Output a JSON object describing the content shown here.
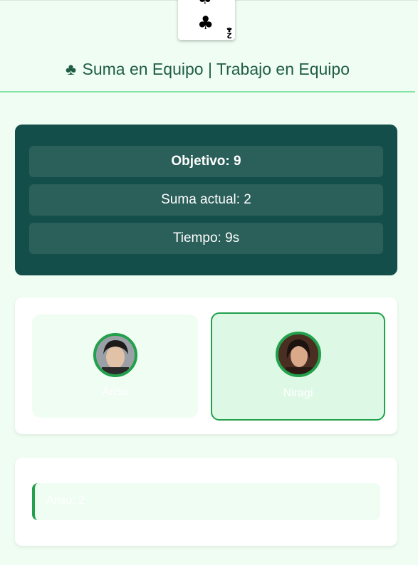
{
  "card": {
    "rank": "2",
    "suit_symbol": "♣"
  },
  "header": {
    "suit_icon": "♣",
    "title": "Suma en Equipo | Trabajo en Equipo"
  },
  "stats": {
    "objective_label": "Objetivo: 9",
    "current_sum_label": "Suma actual: 2",
    "time_label": "Tiempo: 9s"
  },
  "players": [
    {
      "name": "Arisu",
      "selected": false
    },
    {
      "name": "Niragi",
      "selected": true
    }
  ],
  "log": [
    {
      "text": "Arisu: 2"
    }
  ],
  "colors": {
    "background": "#effdf3",
    "panel_dark": "#134e4a",
    "accent_green": "#22a04b",
    "title_green": "#1f5d44"
  }
}
